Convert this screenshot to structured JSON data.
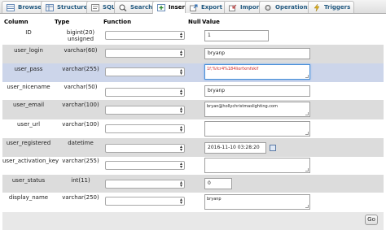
{
  "tabs": [
    {
      "label": "Browse",
      "icon": "browse-icon"
    },
    {
      "label": "Structure",
      "icon": "structure-icon"
    },
    {
      "label": "SQL",
      "icon": "sql-icon"
    },
    {
      "label": "Search",
      "icon": "search-icon"
    },
    {
      "label": "Insert",
      "icon": "insert-icon"
    },
    {
      "label": "Export",
      "icon": "export-icon"
    },
    {
      "label": "Import",
      "icon": "import-icon"
    },
    {
      "label": "Operations",
      "icon": "operations-icon"
    },
    {
      "label": "Triggers",
      "icon": "triggers-icon"
    }
  ],
  "active_tab": "Insert",
  "headers": {
    "column": "Column",
    "type": "Type",
    "function": "Function",
    "null": "Null",
    "value": "Value"
  },
  "rows": [
    {
      "column": "ID",
      "type": "bigint(20) unsigned",
      "value": "1"
    },
    {
      "column": "user_login",
      "type": "varchar(60)",
      "value": "bryanp"
    },
    {
      "column": "user_pass",
      "type": "varchar(255)",
      "value": "1f;%fcr4%184liorfxmfskif"
    },
    {
      "column": "user_nicename",
      "type": "varchar(50)",
      "value": "bryanp"
    },
    {
      "column": "user_email",
      "type": "varchar(100)",
      "value": "bryan@hollychristmaslighting.com"
    },
    {
      "column": "user_url",
      "type": "varchar(100)",
      "value": ""
    },
    {
      "column": "user_registered",
      "type": "datetime",
      "value": "2016-11-10 03:28:20"
    },
    {
      "column": "user_activation_key",
      "type": "varchar(255)",
      "value": ""
    },
    {
      "column": "user_status",
      "type": "int(11)",
      "value": "0"
    },
    {
      "column": "display_name",
      "type": "varchar(250)",
      "value": "bryanp"
    }
  ],
  "go_label": "Go",
  "colors": {
    "tab_text": "#235a81",
    "row_alt": "#dcdcdc",
    "row_highlight": "#ccd5ea",
    "focus_border": "#4a90d9"
  }
}
